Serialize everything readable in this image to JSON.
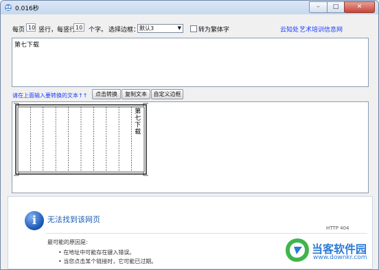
{
  "window": {
    "title": "0.016秒",
    "minimize": "–",
    "maximize": "□",
    "close": "✕"
  },
  "toolbar": {
    "per_page_label": "每页",
    "per_page_value": "10",
    "columns_label": "竖行，每竖行",
    "chars_per_column_value": "10",
    "chars_label": "个字。",
    "border_label": "选择边框：",
    "border_selected": "默认3",
    "traditional_label": "转为繁体字",
    "link_yunzhichu": "云知处",
    "link_art": "艺术培训信息网"
  },
  "input": {
    "text": "第七下载"
  },
  "actions": {
    "prompt": "请在上面输入要转换的文本↑↑",
    "convert_button": "点击转换",
    "copy_button": "复制文本",
    "custom_border_button": "自定义边框"
  },
  "output": {
    "column_text": [
      "第",
      "七",
      "下",
      "载"
    ],
    "column_count": 10
  },
  "browser": {
    "title": "无法找到该网页",
    "http_code": "HTTP 404",
    "reasons_label": "最可能的原因是:",
    "reasons": [
      "在地址中可能存在键入错误。",
      "当您点击某个链接时，它可能已过期。"
    ]
  },
  "watermark": {
    "name": "当客软件园",
    "url": "www.downkr.com"
  },
  "colors": {
    "link": "#1c3cff",
    "error_title": "#1c5eb2",
    "watermark": "#2a7bd6"
  },
  "icons": {
    "app": "app-icon",
    "info": "info-icon",
    "logo": "site-logo-icon"
  }
}
